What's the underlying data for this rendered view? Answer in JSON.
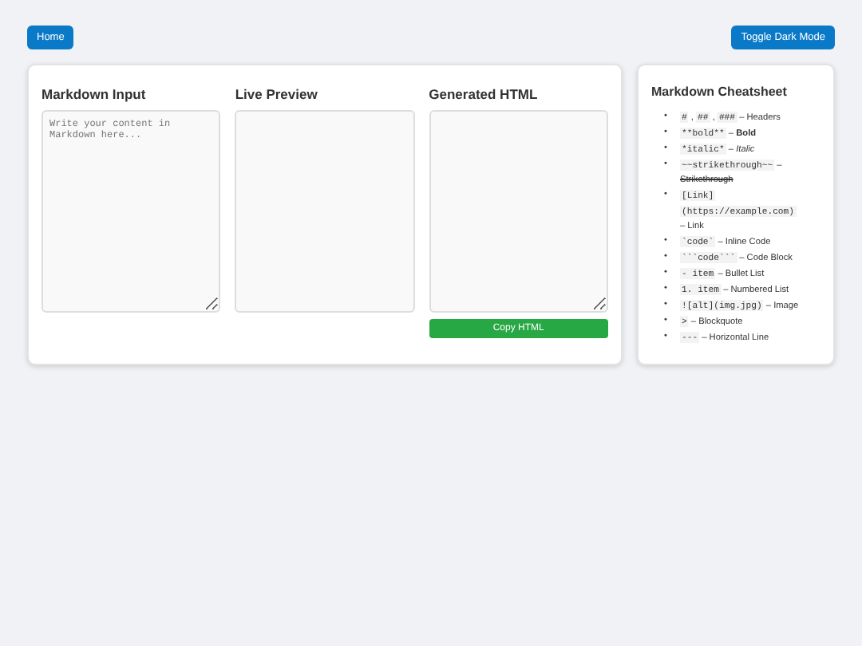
{
  "nav": {
    "home": "Home",
    "toggle": "Toggle Dark Mode"
  },
  "panels": [
    {
      "kind": "input",
      "title": "Markdown Input",
      "placeholder": "Write your content in Markdown here..."
    },
    {
      "kind": "preview",
      "title": "Live Preview"
    },
    {
      "kind": "html",
      "title": "Generated HTML",
      "button": "Copy HTML"
    }
  ],
  "cheatsheet": {
    "title": "Markdown Cheatsheet",
    "marker": "•",
    "items": [
      [
        {
          "kind": "code",
          "text": "#"
        },
        {
          "kind": "text",
          "text": ","
        },
        {
          "kind": "code",
          "text": "##"
        },
        {
          "kind": "text",
          "text": ","
        },
        {
          "kind": "code",
          "text": "###"
        },
        {
          "kind": "text",
          "text": "– Headers"
        }
      ],
      [
        {
          "kind": "code",
          "text": "**bold**"
        },
        {
          "kind": "text",
          "text": "–"
        },
        {
          "kind": "bold",
          "text": "Bold"
        }
      ],
      [
        {
          "kind": "code",
          "text": "*italic*"
        },
        {
          "kind": "text",
          "text": "–"
        },
        {
          "kind": "italic",
          "text": "Italic"
        }
      ],
      [
        {
          "kind": "code",
          "text": "~~strikethrough~~"
        },
        {
          "kind": "text",
          "text": "–"
        },
        {
          "kind": "strike",
          "text": "Strikethrough"
        }
      ],
      [
        {
          "kind": "code",
          "text": "[Link]"
        },
        {
          "kind": "code",
          "text": "(https://example.com)"
        },
        {
          "kind": "text",
          "text": "– Link"
        }
      ],
      [
        {
          "kind": "code",
          "text": "`code`"
        },
        {
          "kind": "text",
          "text": "– Inline Code"
        }
      ],
      [
        {
          "kind": "code",
          "text": "```code```"
        },
        {
          "kind": "text",
          "text": "– Code Block"
        }
      ],
      [
        {
          "kind": "code",
          "text": "- item"
        },
        {
          "kind": "text",
          "text": "– Bullet List"
        }
      ],
      [
        {
          "kind": "code",
          "text": "1. item"
        },
        {
          "kind": "text",
          "text": "– Numbered List"
        }
      ],
      [
        {
          "kind": "code",
          "text": "![alt](img.jpg)"
        },
        {
          "kind": "text",
          "text": "– Image"
        }
      ],
      [
        {
          "kind": "code",
          "text": ">"
        },
        {
          "kind": "text",
          "text": "– Blockquote"
        }
      ],
      [
        {
          "kind": "code",
          "text": "---"
        },
        {
          "kind": "text",
          "text": "– Horizontal Line"
        }
      ]
    ]
  }
}
